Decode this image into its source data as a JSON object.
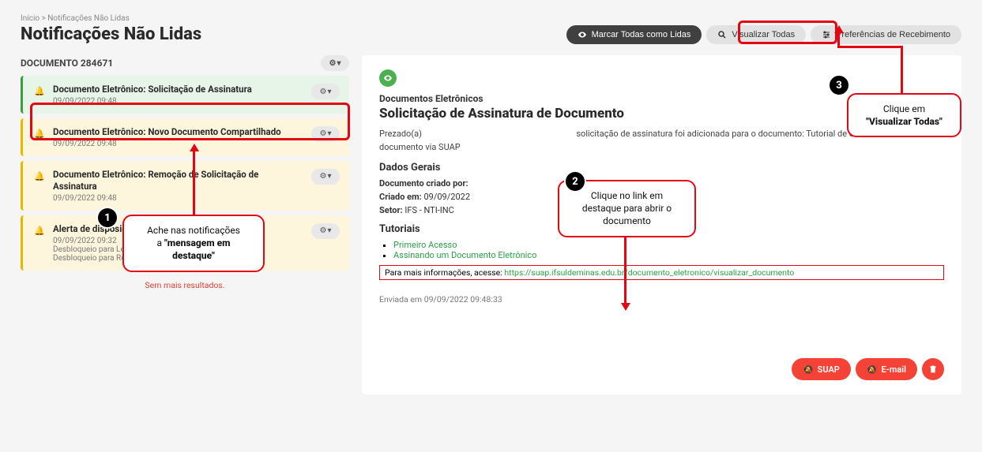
{
  "breadcrumb": "Início  >  Notificações Não Lidas",
  "page_title": "Notificações Não Lidas",
  "header": {
    "mark_all": "Marcar Todas como Lidas",
    "view_all": "Visualizar Todas",
    "prefs": "Preferências de Recebimento"
  },
  "group_title": "DOCUMENTO 284671",
  "notifs": [
    {
      "title": "Documento Eletrônico: Solicitação de Assinatura",
      "meta": "09/09/2022 09:48",
      "kind": "green"
    },
    {
      "title": "Documento Eletrônico: Novo Documento Compartilhado",
      "meta": "09/09/2022 09:48",
      "kind": "yellow"
    },
    {
      "title": "Documento Eletrônico: Remoção de Solicitação de Assinatura",
      "meta": "09/09/2022 09:48",
      "kind": "yellow"
    },
    {
      "title": "Alerta de disposição",
      "meta": "09/09/2022 09:32",
      "extra1": "Desbloqueio para Leitura: 12/09/2022 09:32:11",
      "extra2": "Desbloqueio para Remoção: 12/09/2022 09:32:11",
      "kind": "yellow"
    }
  ],
  "no_more": "Sem mais resultados.",
  "detail": {
    "breadcrumb": "Documentos Eletrônicos",
    "title": "Solicitação de Assinatura de Documento",
    "p_prefix": "Prezado(a)",
    "p_mid": "solicitação de assinatura foi adicionada para o documento: Tutorial de como assinar",
    "p_suffix": "documento via SUAP",
    "sect_dados": "Dados Gerais",
    "row_criado_por_lbl": "Documento criado por:",
    "row_criado_em_lbl": "Criado em:",
    "row_criado_em_val": "09/09/2022",
    "row_setor_lbl": "Setor:",
    "row_setor_val": "IFS - NTI-INC",
    "sect_tut": "Tutoriais",
    "tut1": "Primeiro Acesso",
    "tut2": "Assinando um Documento Eletrônico",
    "info_prefix": "Para mais informações, acesse: ",
    "info_link": "https://suap.ifsuldeminas.edu.br/documento_eletronico/visualizar_documento",
    "sent": "Enviada em 09/09/2022 09:48:33",
    "tag_suap": "SUAP",
    "tag_email": "E-mail"
  },
  "ann": {
    "a1_line1": "Ache nas notificações",
    "a1_line2_pre": "a ",
    "a1_line2_b": "\"mensagem em",
    "a1_line3_b": "destaque\"",
    "a2_line1": "Clique no link em",
    "a2_line2": "destaque para abrir o",
    "a2_line3": "documento",
    "a3_line1": "Clique em",
    "a3_line2_b": "\"Visualizar Todas\"",
    "n1": "1",
    "n2": "2",
    "n3": "3"
  }
}
